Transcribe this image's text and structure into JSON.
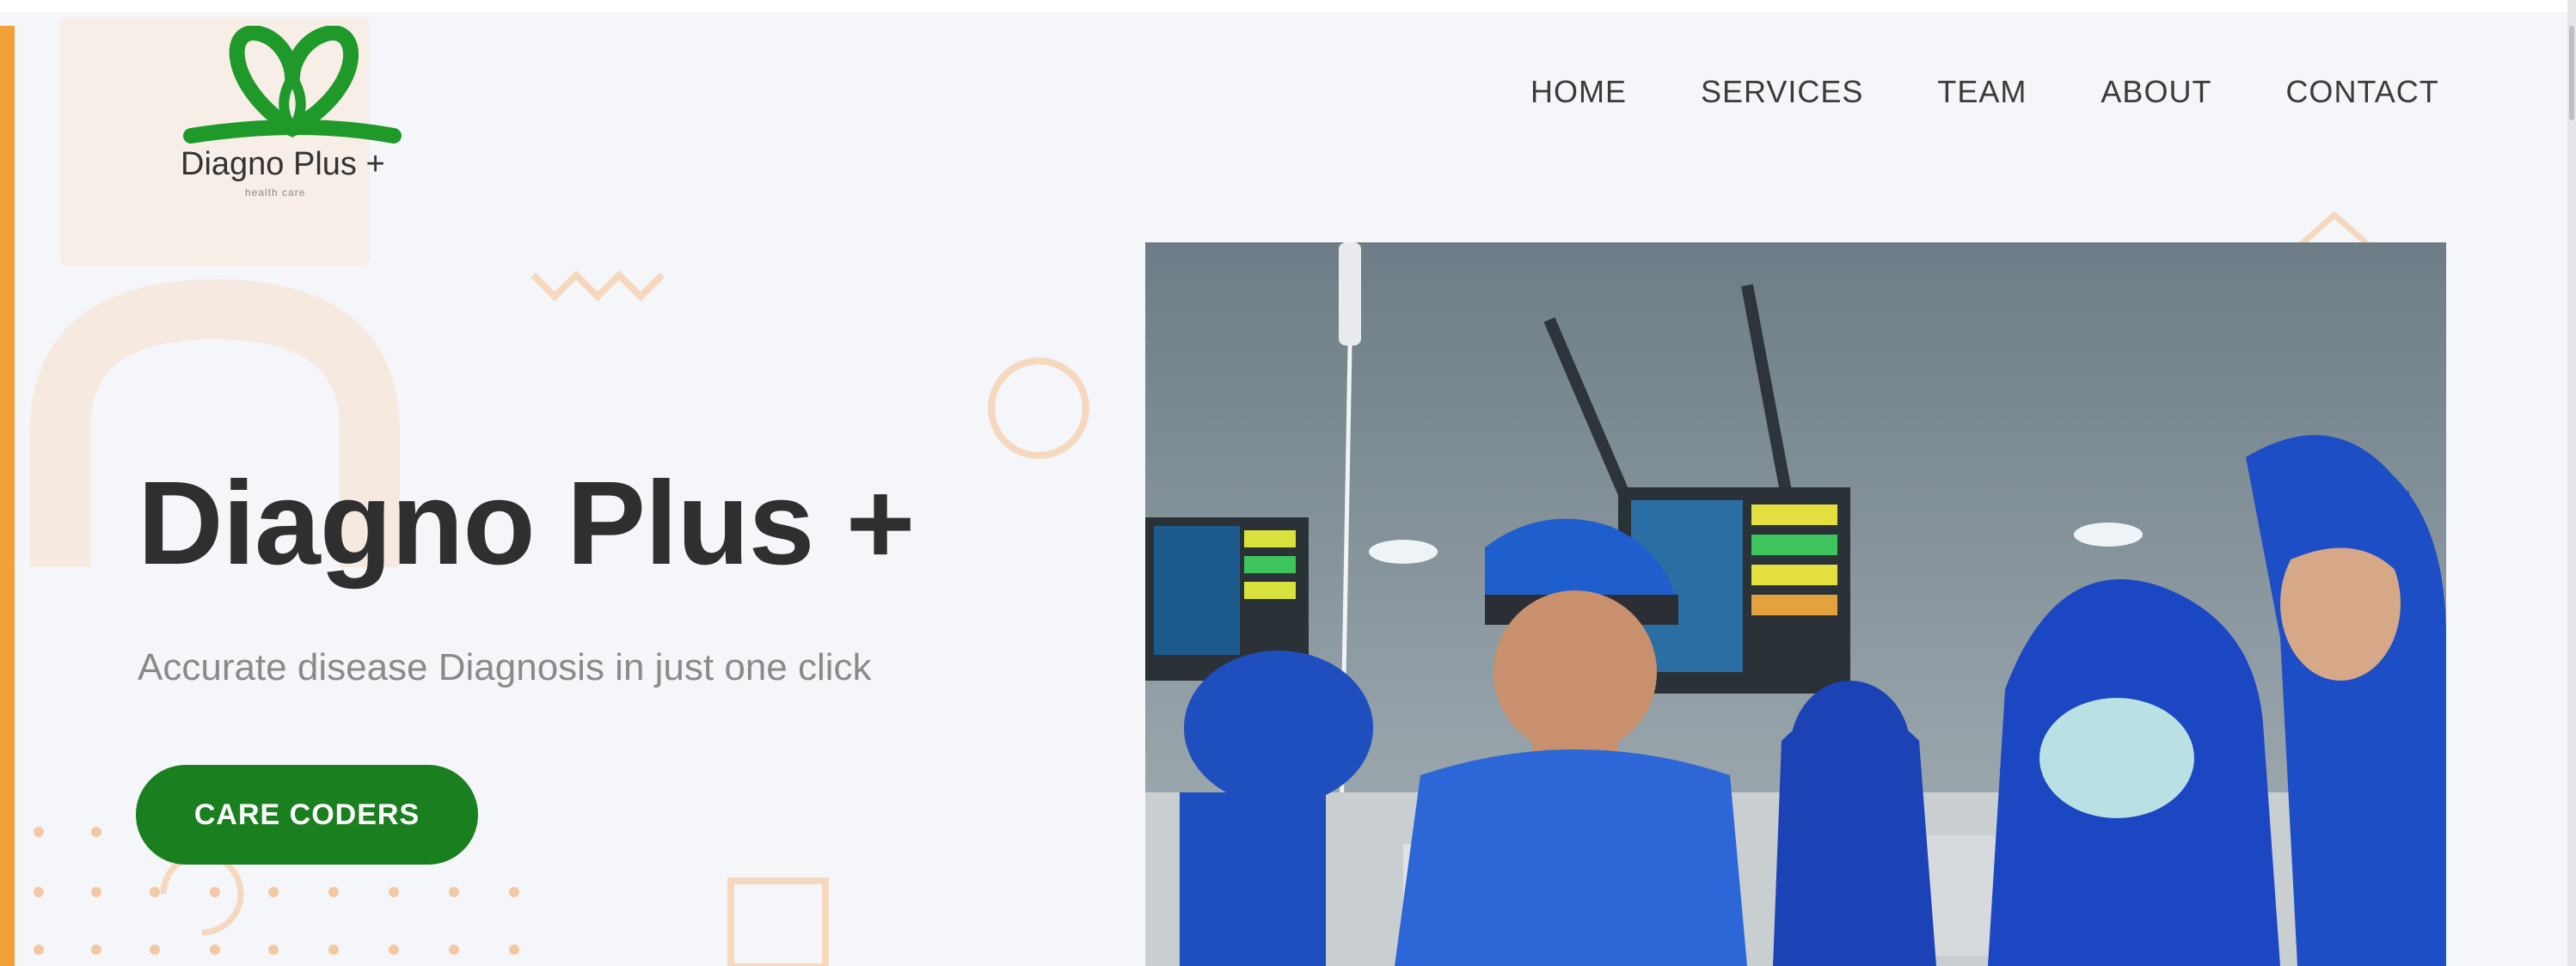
{
  "brand": {
    "name": "Diagno Plus +",
    "tagline": "health care",
    "logo_color": "#1f9a2a"
  },
  "nav": {
    "items": [
      "HOME",
      "SERVICES",
      "TEAM",
      "ABOUT",
      "CONTACT"
    ]
  },
  "hero": {
    "title": "Diagno Plus +",
    "subtitle": "Accurate disease Diagnosis in just one click",
    "cta_label": "CARE CODERS",
    "cta_color": "#1a7f1f",
    "image_icon": "medical-team-photo"
  },
  "colors": {
    "accent": "#f2a13a",
    "background": "#f4f6f9",
    "title": "#2f2f2f"
  }
}
